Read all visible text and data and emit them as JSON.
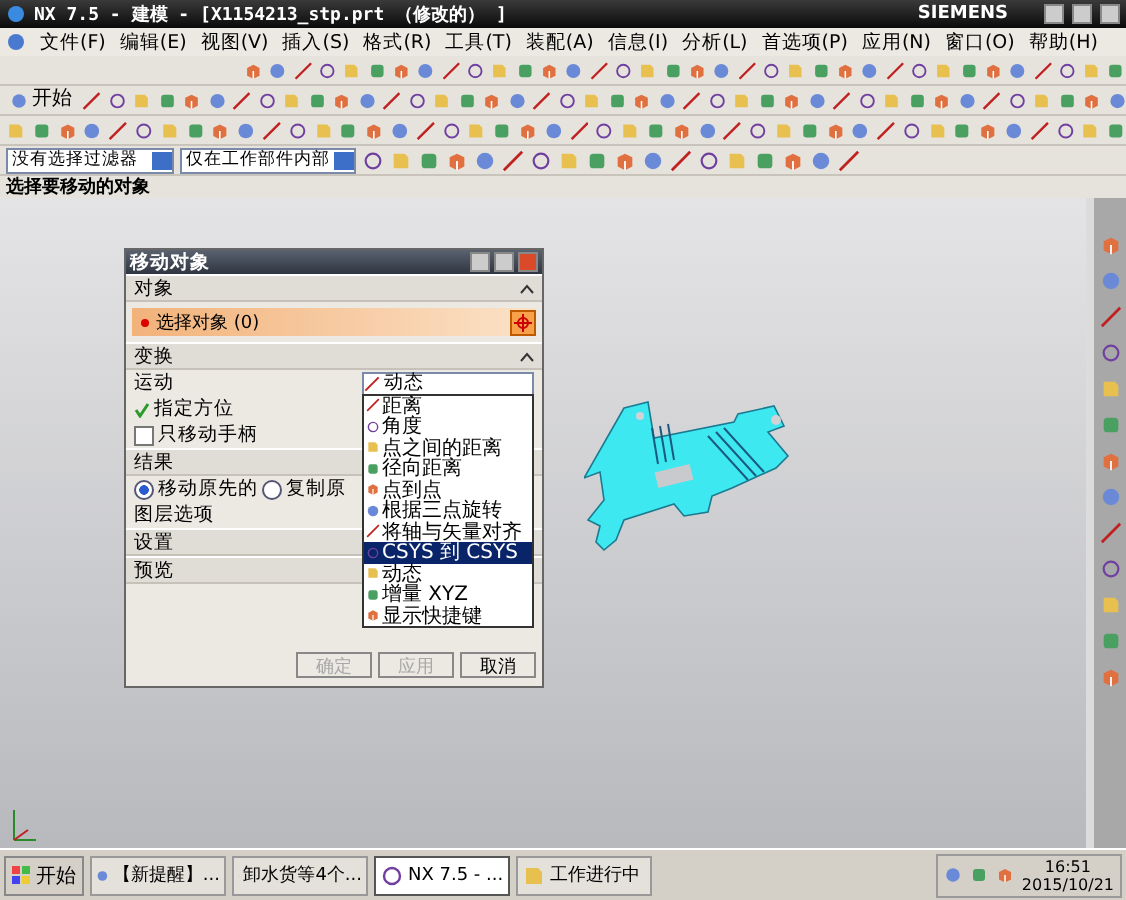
{
  "window": {
    "title": "NX 7.5 - 建模 - [X1154213_stp.prt （修改的） ]",
    "brand": "SIEMENS"
  },
  "menu": [
    "文件(F)",
    "编辑(E)",
    "视图(V)",
    "插入(S)",
    "格式(R)",
    "工具(T)",
    "装配(A)",
    "信息(I)",
    "分析(L)",
    "首选项(P)",
    "应用(N)",
    "窗口(O)",
    "帮助(H)"
  ],
  "start_button": "开始",
  "filters": [
    {
      "value": "没有选择过滤器"
    },
    {
      "value": "仅在工作部件内部"
    }
  ],
  "prompt": "选择要移动的对象",
  "dialog": {
    "title": "移动对象",
    "object_section": {
      "header": "对象",
      "select_label": "选择对象 (0)"
    },
    "transform_section": {
      "header": "变换",
      "motion_label": "运动",
      "motion_value": "动态",
      "orientation_label": "指定方位",
      "handle_only": {
        "label": "只移动手柄",
        "checked": false
      }
    },
    "result_section": {
      "header": "结果",
      "options": [
        {
          "label": "移动原先的",
          "selected": true
        },
        {
          "label": "复制原",
          "selected": false
        }
      ],
      "layer_label": "图层选项"
    },
    "settings_header": "设置",
    "preview_header": "预览",
    "buttons": [
      {
        "label": "确定",
        "disabled": true
      },
      {
        "label": "应用",
        "disabled": true
      },
      {
        "label": "取消",
        "disabled": false
      }
    ]
  },
  "dropdown_list": [
    {
      "label": "距离",
      "selected": false
    },
    {
      "label": "角度",
      "selected": false
    },
    {
      "label": "点之间的距离",
      "selected": false
    },
    {
      "label": "径向距离",
      "selected": false
    },
    {
      "label": "点到点",
      "selected": false
    },
    {
      "label": "根据三点旋转",
      "selected": false
    },
    {
      "label": "将轴与矢量对齐",
      "selected": false
    },
    {
      "label": "CSYS 到 CSYS",
      "selected": true
    },
    {
      "label": "动态",
      "selected": false
    },
    {
      "label": "增量 XYZ",
      "selected": false
    },
    {
      "label": "显示快捷键",
      "selected": false
    }
  ],
  "taskbar": {
    "start": "开始",
    "tasks": [
      {
        "label": "【新提醒】...",
        "selected": false
      },
      {
        "label": "卸水货等4个...",
        "selected": false
      },
      {
        "label": "NX 7.5 - ...",
        "selected": true
      },
      {
        "label": "工作进行中",
        "selected": false
      }
    ],
    "time": "16:51",
    "date": "2015/10/21"
  }
}
